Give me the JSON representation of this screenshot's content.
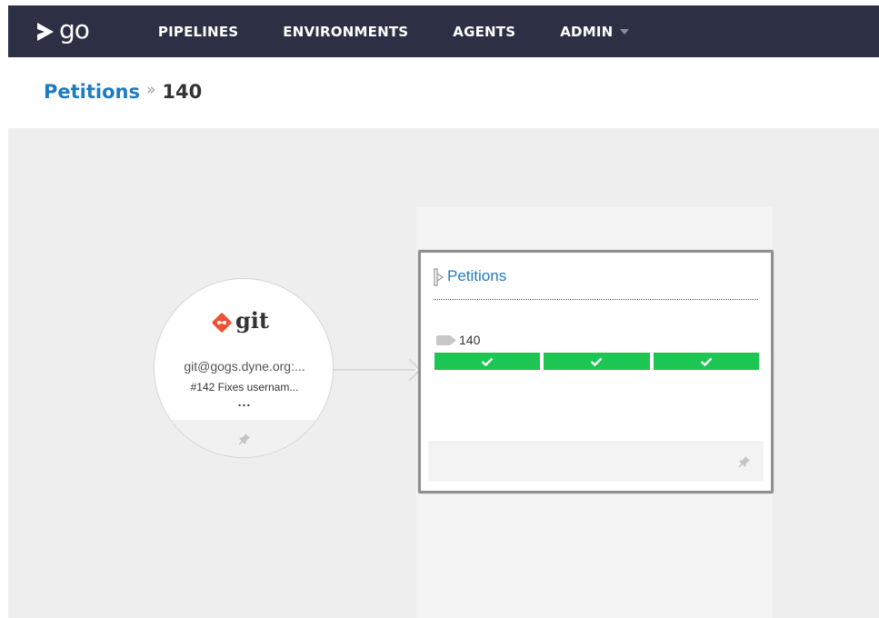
{
  "app": {
    "logo_text": "go",
    "nav": [
      {
        "label": "PIPELINES"
      },
      {
        "label": "ENVIRONMENTS"
      },
      {
        "label": "AGENTS"
      },
      {
        "label": "ADMIN",
        "has_dropdown": true
      }
    ]
  },
  "breadcrumb": {
    "pipeline": "Petitions",
    "separator": "»",
    "counter": "140"
  },
  "material": {
    "type_label": "git",
    "url": "git@gogs.dyne.org:...",
    "commit": "#142 Fixes usernam...",
    "more": "...",
    "icon": "git-logo-icon",
    "pin_icon": "pin-icon"
  },
  "pipeline_card": {
    "name": "Petitions",
    "instance_label": "140",
    "stages": [
      {
        "status": "passed",
        "icon": "check-icon"
      },
      {
        "status": "passed",
        "icon": "check-icon"
      },
      {
        "status": "passed",
        "icon": "check-icon"
      }
    ],
    "pin_icon": "pin-icon"
  },
  "colors": {
    "nav_bg": "#2d2f44",
    "link": "#1f7bc0",
    "stage_passed": "#1dc552",
    "canvas_bg": "#eeeeee",
    "git_orange": "#f05133"
  }
}
